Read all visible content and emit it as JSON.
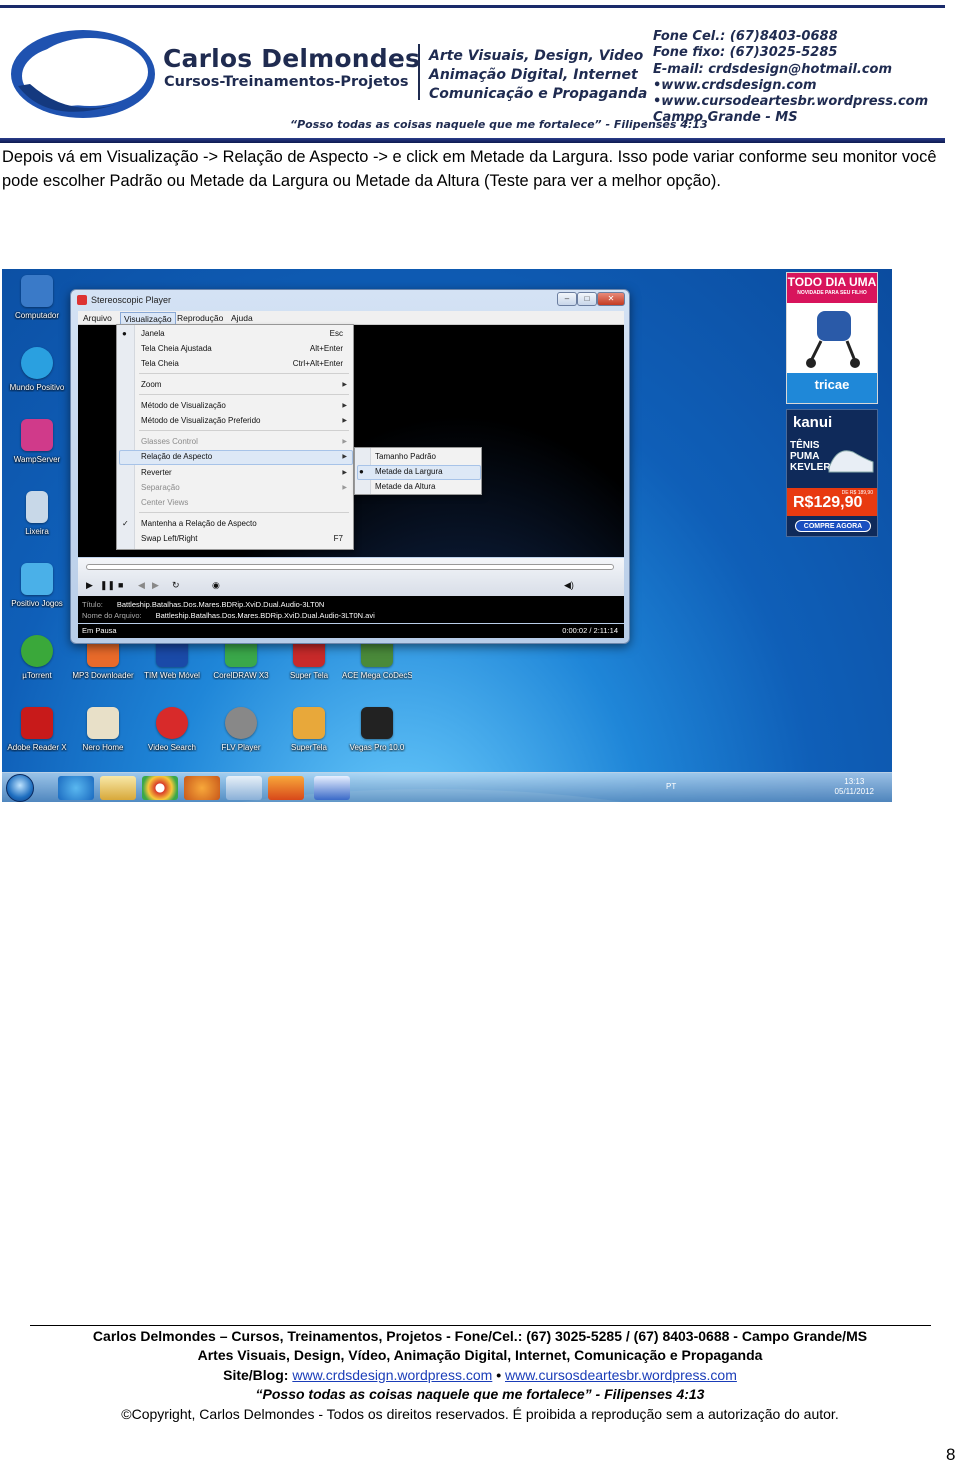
{
  "banner": {
    "brand_name": "Carlos Delmondes",
    "brand_sub": "Cursos-Treinamentos-Projetos",
    "services": [
      "Arte Visuais, Design, Video",
      "Animação Digital, Internet",
      "Comunicação e Propaganda"
    ],
    "contacts": [
      "Fone Cel.: (67)8403-0688",
      "Fone fixo: (67)3025-5285",
      "E-mail: crdsdesign@hotmail.com",
      "•www.crdsdesign.com",
      "•www.cursodeartesbr.wordpress.com",
      "Campo Grande - MS"
    ],
    "motto": "“Posso todas as coisas naquele que me fortalece” - Filipenses 4:13",
    "brand_color": "#1f2b50"
  },
  "intro_text": "Depois vá em Visualização -> Relação de Aspecto -> e click em Metade da Largura. Isso pode variar conforme seu monitor você pode escolher Padrão ou Metade da Largura ou Metade da Altura (Teste para ver a melhor opção).",
  "screenshot": {
    "desktop_icons": [
      {
        "label": "Computador",
        "icon": "computer-icon",
        "color": "#3a7ac8"
      },
      {
        "label": "Mundo Positivo",
        "icon": "globe-icon",
        "color": "#2aa0e0"
      },
      {
        "label": "WampServer",
        "icon": "wamp-icon",
        "color": "#d03a8a"
      },
      {
        "label": "Lixeira",
        "icon": "recycle-bin-icon",
        "color": "#c8d8e8"
      },
      {
        "label": "Positivo Jogos",
        "icon": "gamepad-icon",
        "color": "#4ab0e8"
      },
      {
        "label": "µTorrent",
        "icon": "utorrent-icon",
        "color": "#3aa83a"
      },
      {
        "label": "MP3 Downloader",
        "icon": "mp3-downloader-icon",
        "color": "#e86a2a"
      },
      {
        "label": "TIM Web Móvel",
        "icon": "tim-icon",
        "color": "#1a4aa8"
      },
      {
        "label": "CorelDRAW X3",
        "icon": "coreldraw-icon",
        "color": "#3aa84a"
      },
      {
        "label": "Super Tela",
        "icon": "super-tela-icon",
        "color": "#c82a2a"
      },
      {
        "label": "ACE Mega CoDecS Pa...",
        "icon": "codec-icon",
        "color": "#4a8a3a"
      },
      {
        "label": "Adobe Reader X",
        "icon": "adobe-reader-icon",
        "color": "#c81a1a"
      },
      {
        "label": "Nero Home",
        "icon": "nero-icon",
        "color": "#e8e0c8"
      },
      {
        "label": "Video Search",
        "icon": "youtube-search-icon",
        "color": "#d82a2a"
      },
      {
        "label": "FLV Player",
        "icon": "speaker-icon",
        "color": "#888"
      },
      {
        "label": "SuperTela",
        "icon": "box-icon",
        "color": "#e8a83a"
      },
      {
        "label": "Vegas Pro 10.0",
        "icon": "vegas-icon",
        "color": "#222"
      }
    ],
    "player": {
      "title": "Stereoscopic Player",
      "menus": [
        "Arquivo",
        "Visualização",
        "Reprodução",
        "Ajuda"
      ],
      "active_menu": "Visualização",
      "info_title_label": "Título:",
      "info_title": "Battleship.Batalhas.Dos.Mares.BDRip.XviD.Dual.Audio-3LT0N",
      "info_file_label": "Nome do Arquivo:",
      "info_file": "Battleship.Batalhas.Dos.Mares.BDRip.XviD.Dual.Audio-3LT0N.avi",
      "status": "Em Pausa",
      "time": "0:00:02 / 2:11:14"
    },
    "menu": {
      "items": [
        {
          "label": "Janela",
          "key": "Esc"
        },
        {
          "label": "Tela Cheia Ajustada",
          "key": "Alt+Enter"
        },
        {
          "label": "Tela Cheia",
          "key": "Ctrl+Alt+Enter"
        },
        {
          "label": "Zoom"
        },
        {
          "label": "Método de Visualização"
        },
        {
          "label": "Método de Visualização Preferido"
        },
        {
          "label": "Glasses Control"
        },
        {
          "label": "Relação de Aspecto"
        },
        {
          "label": "Reverter"
        },
        {
          "label": "Separação"
        },
        {
          "label": "Center Views"
        },
        {
          "label": "Mantenha a Relação de Aspecto"
        },
        {
          "label": "Swap Left/Right",
          "key": "F7"
        }
      ],
      "submenu": [
        "Tamanho Padrão",
        "Metade da Largura",
        "Metade da Altura"
      ],
      "submenu_selected": "Metade da Largura"
    },
    "ads": {
      "ad1_title": "TODO DIA UMA",
      "ad1_sub": "NOVIDADE PARA SEU FILHO",
      "ad1_brand": "tricae",
      "ad2_brand": "kanui",
      "ad2_product": [
        "TÊNIS",
        "PUMA",
        "KEVLER"
      ],
      "ad2_old_price": "DE R$ 189,90",
      "ad2_price": "R$129,90",
      "ad2_cta": "COMPRE AGORA"
    },
    "taskbar": {
      "lang": "PT",
      "time": "13:13",
      "date": "05/11/2012"
    }
  },
  "footer": {
    "line1": "Carlos Delmondes – Cursos, Treinamentos, Projetos - Fone/Cel.: (67) 3025-5285 / (67) 8403-0688  - Campo Grande/MS",
    "line2": "Artes Visuais, Design, Vídeo, Animação Digital, Internet, Comunicação e Propaganda",
    "site_label": "Site/Blog:",
    "site1": "www.crdsdesign.wordpress.com",
    "bullet": "•",
    "site2": "www.cursosdeartesbr.wordpress.com",
    "motto": "“Posso todas as coisas naquele que me fortalece” - Filipenses 4:13",
    "copyright": "©Copyright, Carlos Delmondes - Todos os direitos reservados. É proibida a reprodução sem a autorização do autor.",
    "link_color": "#1a3db8"
  },
  "page_number": "8"
}
